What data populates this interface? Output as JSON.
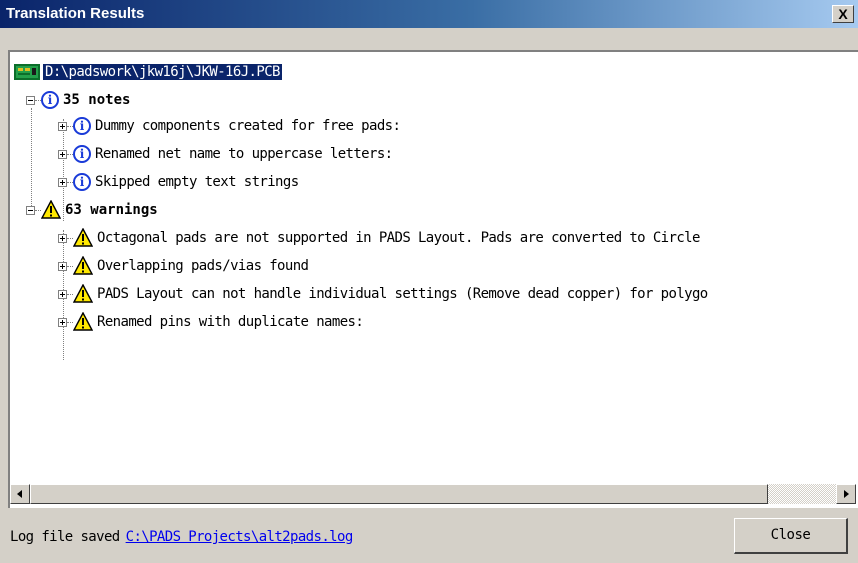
{
  "window": {
    "title": "Translation Results",
    "close_glyph": "X"
  },
  "tree": {
    "root": {
      "label": "D:\\padswork\\jkw16j\\JKW-16J.PCB",
      "icon": "pcb-icon"
    },
    "groups": [
      {
        "label": "35 notes",
        "icon": "info-icon",
        "expanded": true,
        "items": [
          {
            "label": "Dummy components created for free pads:",
            "icon": "info-icon"
          },
          {
            "label": "Renamed net name to uppercase letters:",
            "icon": "info-icon"
          },
          {
            "label": "Skipped empty text strings",
            "icon": "info-icon"
          }
        ]
      },
      {
        "label": "63 warnings",
        "icon": "warning-icon",
        "expanded": true,
        "items": [
          {
            "label": "Octagonal pads are not supported in PADS Layout. Pads are converted to Circle",
            "icon": "warning-icon"
          },
          {
            "label": "Overlapping pads/vias found",
            "icon": "warning-icon"
          },
          {
            "label": "PADS Layout can not handle individual settings (Remove dead copper) for polygo",
            "icon": "warning-icon"
          },
          {
            "label": "Renamed pins with duplicate names:",
            "icon": "warning-icon"
          }
        ]
      }
    ]
  },
  "footer": {
    "log_label": "Log file saved",
    "log_link": "C:\\PADS Projects\\alt2pads.log",
    "close_button": "Close"
  },
  "colors": {
    "title_gradient_start": "#0a246a",
    "title_gradient_end": "#a6caf0",
    "info_blue": "#1a3bd8",
    "warning_yellow": "#ffe800",
    "selection": "#0a246a"
  }
}
